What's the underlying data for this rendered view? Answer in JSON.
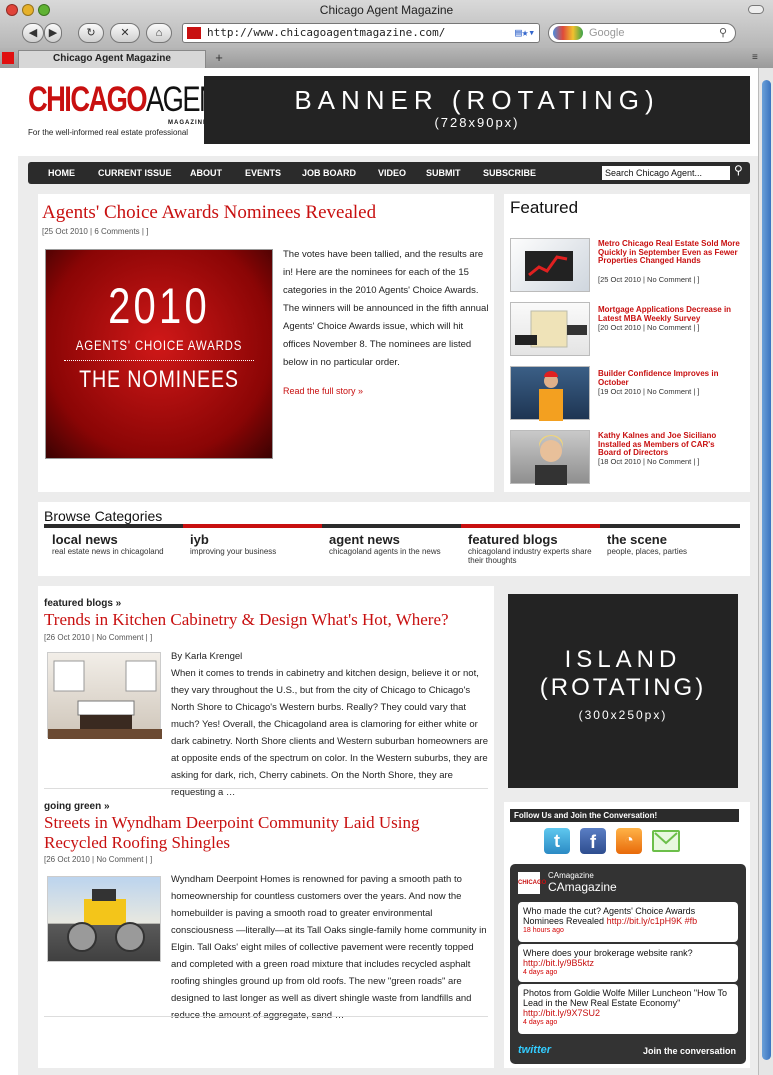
{
  "browser": {
    "window_title": "Chicago Agent Magazine",
    "url": "http://www.chicagoagentmagazine.com/",
    "search_placeholder": "Google",
    "tab_label": "Chicago Agent Magazine",
    "new_tab": "+"
  },
  "header": {
    "logo_main": "CHICAGO",
    "logo_agent": "AGENT",
    "logo_magazine": "MAGAZINE",
    "tagline": "For the well-informed real estate professional",
    "banner_text": "BANNER (ROTATING)",
    "banner_size": "(728x90px)"
  },
  "nav": {
    "items": [
      "HOME",
      "CURRENT ISSUE",
      "ABOUT",
      "EVENTS",
      "JOB BOARD",
      "VIDEO",
      "SUBMIT",
      "SUBSCRIBE"
    ],
    "search_placeholder": "Search Chicago Agent..."
  },
  "lead": {
    "title": "Agents' Choice Awards Nominees Revealed",
    "meta": "[25 Oct 2010 | 6 Comments | ]",
    "image_year": "2010",
    "image_line1": "AGENTS' CHOICE AWARDS",
    "image_line2": "THE NOMINEES",
    "body": "The votes have been tallied, and the results are in! Here are the nominees for each of the 15 categories in the 2010 Agents' Choice Awards. The winners will be announced in the fifth annual Agents' Choice Awards issue, which will hit offices November 8. The nominees are listed below in no particular order.",
    "read_more": "Read the full story »"
  },
  "featured": {
    "heading": "Featured",
    "items": [
      {
        "title": "Metro Chicago Real Estate Sold More Quickly in September Even as Fewer Properties Changed Hands",
        "meta": "[25 Oct 2010 | No Comment | ]"
      },
      {
        "title": "Mortgage Applications Decrease in Latest MBA Weekly Survey",
        "meta": "[20 Oct 2010 | No Comment | ]"
      },
      {
        "title": "Builder Confidence Improves in October",
        "meta": "[19 Oct 2010 | No Comment | ]"
      },
      {
        "title": "Kathy Kalnes and Joe Siciliano Installed as Members of CAR's Board of Directors",
        "meta": "[18 Oct 2010 | No Comment | ]"
      }
    ]
  },
  "categories": {
    "heading": "Browse Categories",
    "items": [
      {
        "title": "local news",
        "sub": "real estate news in chicagoland"
      },
      {
        "title": "iyb",
        "sub": "improving your business"
      },
      {
        "title": "agent news",
        "sub": "chicagoland agents in the news"
      },
      {
        "title": "featured blogs",
        "sub": "chicagoland industry experts share their thoughts"
      },
      {
        "title": "the scene",
        "sub": "people, places, parties"
      }
    ]
  },
  "articles": [
    {
      "section": "featured blogs »",
      "title": "Trends in Kitchen Cabinetry & Design What's Hot, Where?",
      "meta": "[26 Oct 2010 | No Comment | ]",
      "byline": "By Karla Krengel",
      "body": "When it comes to trends in cabinetry and kitchen design, believe it or not, they vary throughout the U.S., but from the city of Chicago to Chicago's North Shore to Chicago's Western burbs. Really? They could vary that much? Yes! Overall, the Chicagoland area is clamoring for either white or dark cabinetry. North Shore clients and Western suburban homeowners are at opposite ends of the spectrum on color. In the Western suburbs, they are asking for dark, rich, Cherry cabinets. On the North Shore, they are requesting a …"
    },
    {
      "section": "going green »",
      "title": "Streets in Wyndham Deerpoint Community Laid Using Recycled Roofing Shingles",
      "meta": "[26 Oct 2010 | No Comment | ]",
      "body": "Wyndham Deerpoint Homes is renowned for paving a smooth path to homeownership for countless customers over the years. And now the homebuilder is paving a smooth road to greater environmental consciousness —literally—at its Tall Oaks single-family home community in Elgin. Tall Oaks' eight miles of collective pavement were recently topped and completed with a green road mixture that includes recycled asphalt roofing shingles ground up from old roofs. The new \"green roads\" are designed to last longer as well as divert shingle waste from landfills and reduce the amount of aggregate, sand …"
    }
  ],
  "island": {
    "line1": "ISLAND",
    "line2": "(ROTATING)",
    "size": "(300x250px)"
  },
  "social": {
    "heading": "Follow Us and Join the Conversation!",
    "twitter_user": "CAmagazine",
    "twitter_user_small": "CAmagazine",
    "tweets": [
      {
        "text": "Who made the cut? Agents' Choice Awards Nominees Revealed",
        "link": "http://bit.ly/c1pH9K #fb",
        "time": "18 hours ago"
      },
      {
        "text": "Where does your brokerage website rank?",
        "link": "http://bit.ly/9B5ktz",
        "time": "4 days ago"
      },
      {
        "text": "Photos from Goldie Wolfe Miller Luncheon \"How To Lead in the New Real Estate Economy\"",
        "link": "http://bit.ly/9X7SU2",
        "time": "4 days ago"
      }
    ],
    "twitter_logo": "twitter",
    "join": "Join the conversation"
  },
  "colors": {
    "accent_red": "#c81010",
    "nav_dark": "#2b2b2b",
    "twitter_blue": "#33ccff"
  }
}
